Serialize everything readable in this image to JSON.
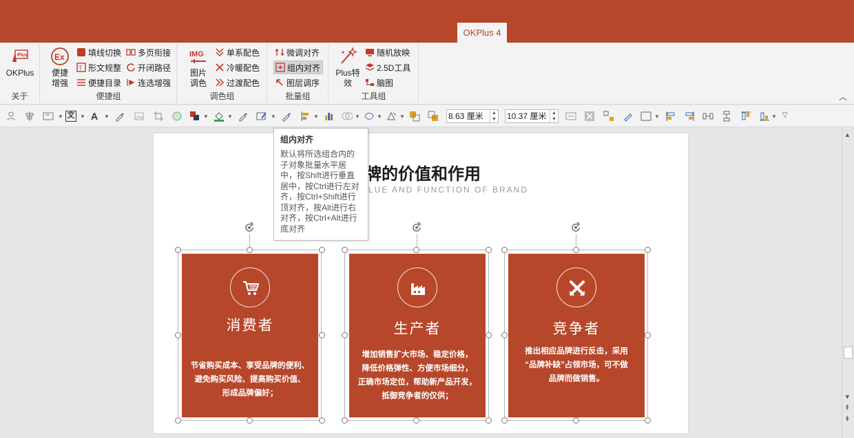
{
  "window": {
    "active_tab": "OKPlus 4"
  },
  "ribbon": {
    "groups": [
      {
        "label": "关于",
        "buttons": [
          {
            "label": "OKPlus",
            "icon": "okplus-logo-icon"
          }
        ]
      },
      {
        "label": "便捷组",
        "buttons": [
          {
            "label": "便捷\n增强",
            "icon": "ex-circle-icon"
          },
          {
            "label": "填线切换",
            "icon": "fill-line-icon"
          },
          {
            "label": "形文规整",
            "icon": "shape-text-icon"
          },
          {
            "label": "便捷目录",
            "icon": "list-icon"
          },
          {
            "label": "多页衔接",
            "icon": "multipage-icon"
          },
          {
            "label": "开闭路径",
            "icon": "path-icon"
          },
          {
            "label": "连选增强",
            "icon": "multiselect-icon"
          }
        ]
      },
      {
        "label": "调色组",
        "buttons": [
          {
            "label": "图片\n调色",
            "icon": "img-icon"
          },
          {
            "label": "单系配色",
            "icon": "single-color-icon"
          },
          {
            "label": "冷暖配色",
            "icon": "warm-cool-icon"
          },
          {
            "label": "过渡配色",
            "icon": "gradient-icon"
          }
        ]
      },
      {
        "label": "批量组",
        "buttons": [
          {
            "label": "微调对齐",
            "icon": "fine-align-icon"
          },
          {
            "label": "组内对齐",
            "icon": "group-align-icon",
            "selected": true
          },
          {
            "label": "图层调序",
            "icon": "layer-order-icon"
          }
        ]
      },
      {
        "label": "工具组",
        "buttons": [
          {
            "label": "Plus特\n效",
            "icon": "sparkle-icon"
          },
          {
            "label": "随机放映",
            "icon": "random-show-icon"
          },
          {
            "label": "2.5D工具",
            "icon": "2-5d-icon"
          },
          {
            "label": "脑图",
            "icon": "mindmap-icon"
          }
        ]
      }
    ],
    "tooltip": {
      "title": "组内对齐",
      "body": "默认将所选组合内的子对象批量水平居中，按Shift进行垂直居中，按Ctrl进行左对齐，按Ctrl+Shift进行顶对齐，按Alt进行右对齐，按Ctrl+Alt进行底对齐"
    }
  },
  "toolbar": {
    "width_value": "8.63 厘米",
    "height_value": "10.37 厘米",
    "text_icon_label": "文",
    "font_color_label": "A"
  },
  "slide": {
    "title": "牌的价值和作用",
    "subtitle": "LUE AND FUNCTION OF BRAND",
    "accent_color": "#b7472a",
    "cards": [
      {
        "title": "消费者",
        "icon": "shopping-cart-icon",
        "lines": [
          "节省购买成本、享受品牌的便利、",
          "避免购买风险、提高购买价值、",
          "形成品牌偏好；"
        ]
      },
      {
        "title": "生产者",
        "icon": "factory-icon",
        "lines": [
          "增加销售扩大市场、稳定价格，",
          "降低价格弹性、方便市场细分，",
          "正确市场定位，帮助新产品开发，",
          "抵御竞争者的仅供；"
        ]
      },
      {
        "title": "竞争者",
        "icon": "crossed-swords-icon",
        "lines": [
          "推出相应品牌进行反击，采用",
          "“品牌补缺”占领市场，可不做",
          "品牌而做销售。"
        ]
      }
    ]
  }
}
